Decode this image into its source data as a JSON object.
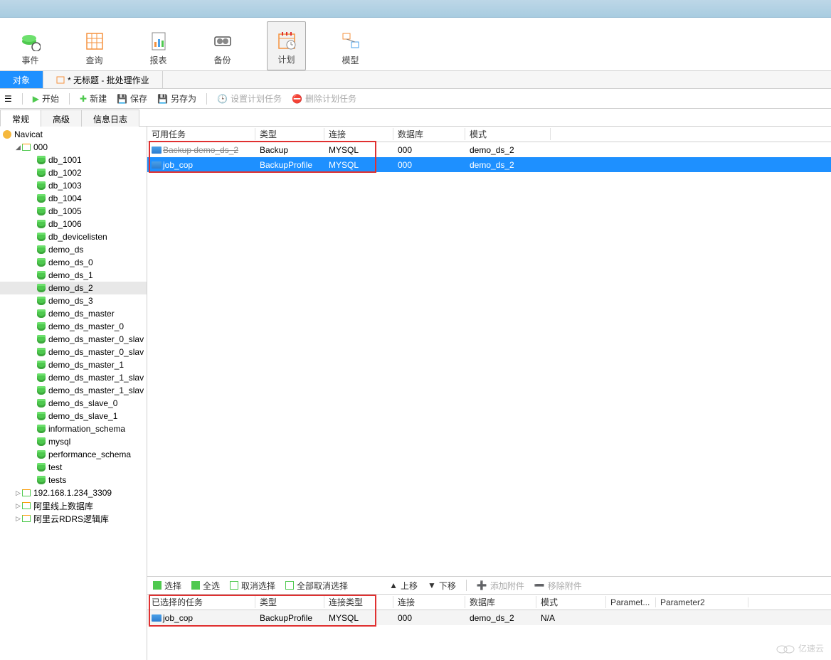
{
  "ribbon": {
    "items": [
      {
        "label": "事件",
        "icon": "event"
      },
      {
        "label": "查询",
        "icon": "query"
      },
      {
        "label": "报表",
        "icon": "report"
      },
      {
        "label": "备份",
        "icon": "backup"
      },
      {
        "label": "计划",
        "icon": "schedule",
        "active": true
      },
      {
        "label": "模型",
        "icon": "model"
      }
    ]
  },
  "tabs": {
    "items": [
      {
        "label": "对象",
        "active": true
      },
      {
        "label": "* 无标题 - 批处理作业"
      }
    ]
  },
  "secondbar": {
    "start": "开始",
    "new": "新建",
    "save": "保存",
    "saveas": "另存为",
    "setplan": "设置计划任务",
    "delplan": "删除计划任务"
  },
  "subtabs": {
    "items": [
      "常规",
      "高级",
      "信息日志"
    ],
    "active": 0
  },
  "tree": {
    "root": "Navicat",
    "conn": "000",
    "dbs": [
      "db_1001",
      "db_1002",
      "db_1003",
      "db_1004",
      "db_1005",
      "db_1006",
      "db_devicelisten",
      "demo_ds",
      "demo_ds_0",
      "demo_ds_1",
      "demo_ds_2",
      "demo_ds_3",
      "demo_ds_master",
      "demo_ds_master_0",
      "demo_ds_master_0_slav",
      "demo_ds_master_0_slav",
      "demo_ds_master_1",
      "demo_ds_master_1_slav",
      "demo_ds_master_1_slav",
      "demo_ds_slave_0",
      "demo_ds_slave_1",
      "information_schema",
      "mysql",
      "performance_schema",
      "test",
      "tests"
    ],
    "selected": "demo_ds_2",
    "otherConns": [
      "192.168.1.234_3309",
      "阿里线上数据库",
      "阿里云RDRS逻辑库"
    ]
  },
  "topgrid": {
    "headers": [
      "可用任务",
      "类型",
      "连接",
      "数据库",
      "模式"
    ],
    "rows": [
      {
        "name": "Backup demo_ds_2",
        "type": "Backup",
        "conn": "MYSQL",
        "db": "000",
        "schema": "demo_ds_2",
        "strike": true
      },
      {
        "name": "job_cop",
        "type": "BackupProfile",
        "conn": "MYSQL",
        "db": "000",
        "schema": "demo_ds_2",
        "selected": true
      }
    ]
  },
  "bottombar": {
    "select": "选择",
    "selectall": "全选",
    "deselect": "取消选择",
    "deselectall": "全部取消选择",
    "moveup": "上移",
    "movedown": "下移",
    "addattach": "添加附件",
    "removeattach": "移除附件"
  },
  "bottomgrid": {
    "headers": [
      "已选择的任务",
      "类型",
      "连接类型",
      "连接",
      "数据库",
      "模式",
      "Paramet...",
      "Parameter2"
    ],
    "row": {
      "name": "job_cop",
      "type": "BackupProfile",
      "conntype": "MYSQL",
      "conn": "000",
      "db": "demo_ds_2",
      "schema": "N/A"
    }
  },
  "watermark": "亿速云"
}
